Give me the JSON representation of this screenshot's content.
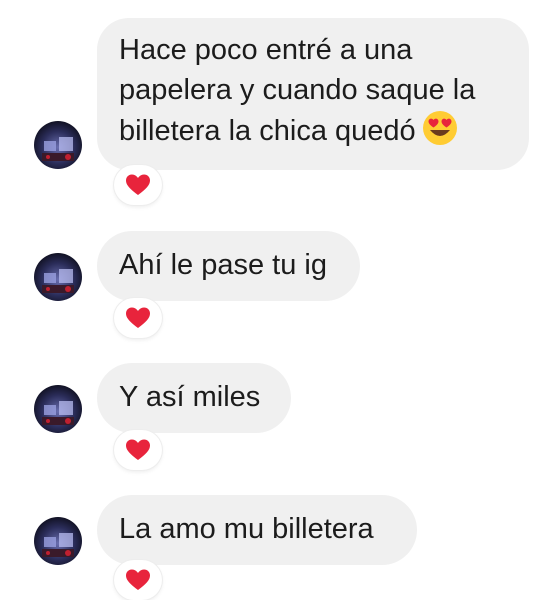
{
  "messages": [
    {
      "lines": [
        "Hace poco entré a una",
        "papelera y cuando saque la",
        "billetera la chica quedó"
      ],
      "emoji": "heart-eyes-emoji",
      "reaction": "red-heart"
    },
    {
      "lines": [
        "Ahí le pase tu ig"
      ],
      "reaction": "red-heart"
    },
    {
      "lines": [
        "Y así miles"
      ],
      "reaction": "red-heart"
    },
    {
      "lines": [
        "La amo mu billetera"
      ],
      "reaction": "red-heart"
    }
  ],
  "colors": {
    "bubble": "#f0f0f0",
    "text": "#1c1c1c",
    "heart": "#e8243c"
  }
}
